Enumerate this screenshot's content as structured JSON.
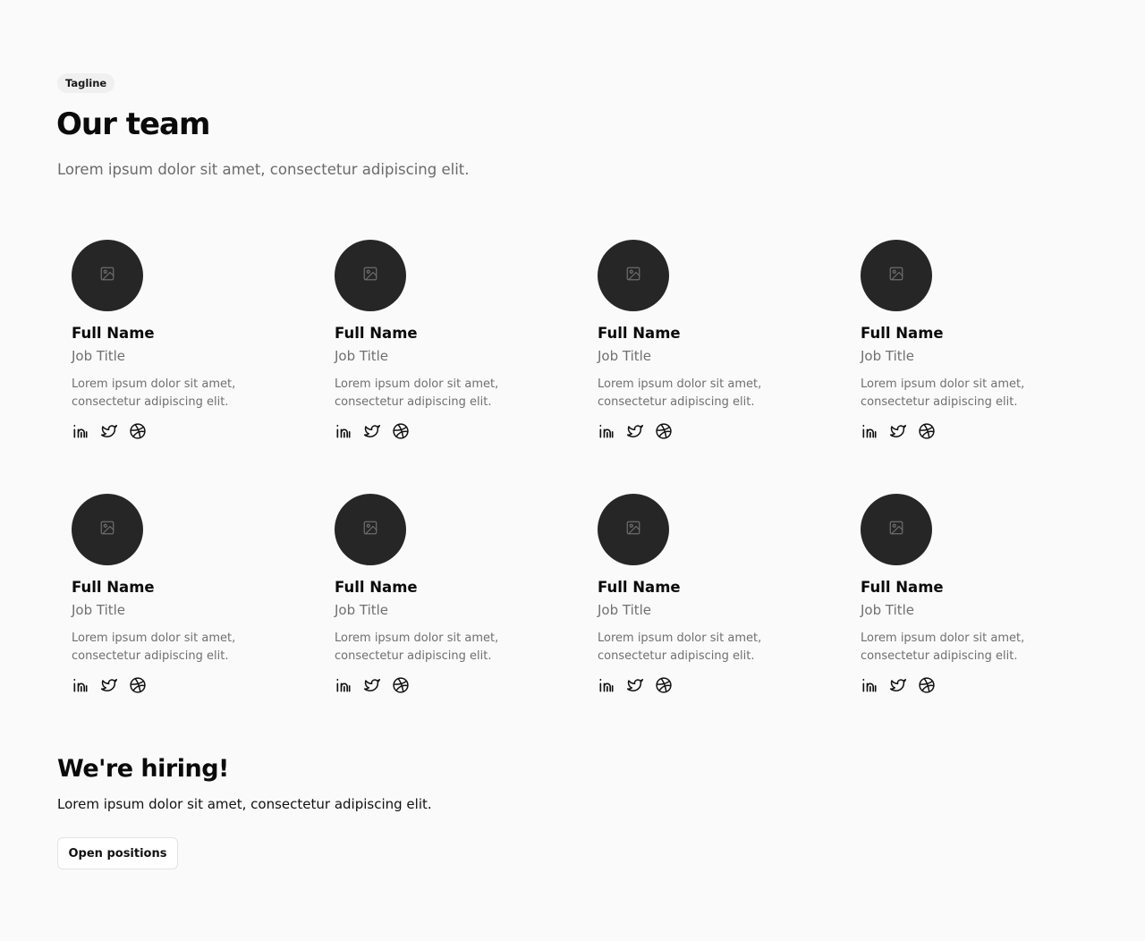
{
  "header": {
    "tagline": "Tagline",
    "title": "Our team",
    "subtitle": "Lorem ipsum dolor sit amet, consectetur adipiscing elit."
  },
  "icons": {
    "avatar_placeholder": "image-placeholder-icon",
    "socials": [
      "linkedin-icon",
      "twitter-icon",
      "dribbble-icon"
    ]
  },
  "colors": {
    "background": "#fafafa",
    "avatar": "#262626",
    "muted_text": "#707070"
  },
  "members": [
    {
      "name": "Full Name",
      "job_title": "Job Title",
      "bio": "Lorem ipsum dolor sit amet, consectetur adipiscing elit."
    },
    {
      "name": "Full Name",
      "job_title": "Job Title",
      "bio": "Lorem ipsum dolor sit amet, consectetur adipiscing elit."
    },
    {
      "name": "Full Name",
      "job_title": "Job Title",
      "bio": "Lorem ipsum dolor sit amet, consectetur adipiscing elit."
    },
    {
      "name": "Full Name",
      "job_title": "Job Title",
      "bio": "Lorem ipsum dolor sit amet, consectetur adipiscing elit."
    },
    {
      "name": "Full Name",
      "job_title": "Job Title",
      "bio": "Lorem ipsum dolor sit amet, consectetur adipiscing elit."
    },
    {
      "name": "Full Name",
      "job_title": "Job Title",
      "bio": "Lorem ipsum dolor sit amet, consectetur adipiscing elit."
    },
    {
      "name": "Full Name",
      "job_title": "Job Title",
      "bio": "Lorem ipsum dolor sit amet, consectetur adipiscing elit."
    },
    {
      "name": "Full Name",
      "job_title": "Job Title",
      "bio": "Lorem ipsum dolor sit amet, consectetur adipiscing elit."
    }
  ],
  "hiring": {
    "title": "We're hiring!",
    "text": "Lorem ipsum dolor sit amet, consectetur adipiscing elit.",
    "button_label": "Open positions"
  }
}
